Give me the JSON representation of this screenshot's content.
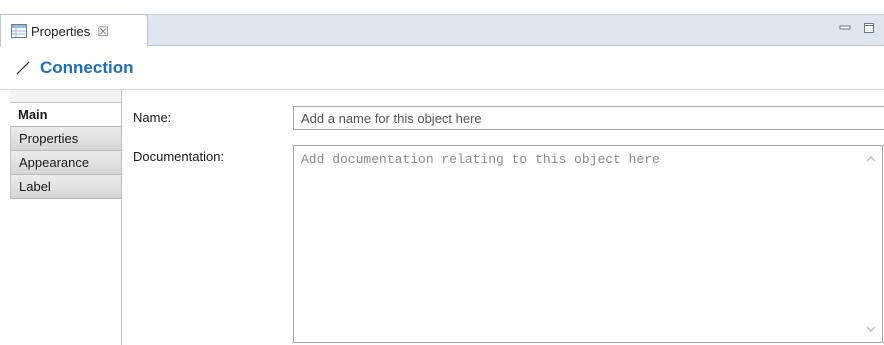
{
  "view_tab": {
    "label": "Properties",
    "close": "☒"
  },
  "title": "Connection",
  "side_tabs": [
    "Main",
    "Properties",
    "Appearance",
    "Label"
  ],
  "active_side_tab": "Main",
  "form": {
    "name_label": "Name:",
    "name_placeholder": "Add a name for this object here",
    "doc_label": "Documentation:",
    "doc_placeholder": "Add documentation relating to this object here"
  },
  "colors": {
    "accent": "#1c6fc0",
    "tabbar": "#dfe6ef"
  }
}
